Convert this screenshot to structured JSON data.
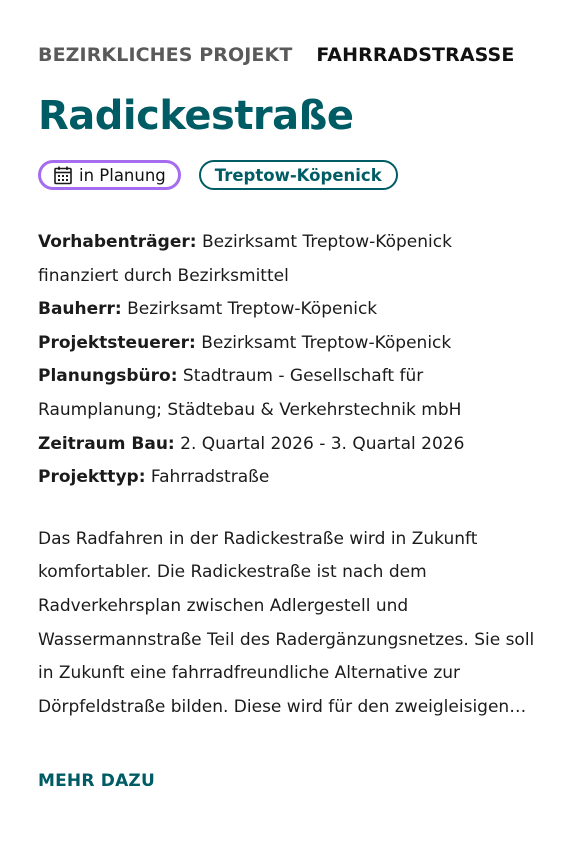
{
  "project": {
    "type_label": "BEZIRKLICHES PROJEKT",
    "category_label": "FAHRRADSTRASSE",
    "title": "Radickestraße",
    "status": {
      "label": "in Planung",
      "icon": "calendar-icon",
      "color": "#a56cf0"
    },
    "district": {
      "label": "Treptow-Köpenick",
      "color": "#005c64"
    },
    "details": [
      {
        "key": "Vorhabenträger:",
        "value": "Bezirksamt Treptow-Köpenick finanziert durch Bezirksmittel"
      },
      {
        "key": "Bauherr:",
        "value": "Bezirksamt Treptow-Köpenick"
      },
      {
        "key": "Projektsteuerer:",
        "value": "Bezirksamt Treptow-Köpenick"
      },
      {
        "key": "Planungsbüro:",
        "value": "Stadtraum - Gesellschaft für Raumplanung; Städtebau & Verkehrstechnik mbH"
      },
      {
        "key": "Zeitraum Bau:",
        "value": "2. Quartal 2026 - 3. Quartal 2026"
      },
      {
        "key": "Projekttyp:",
        "value": "Fahrradstraße"
      }
    ],
    "summary": "Das Radfahren in der Radickestraße wird in Zukunft komfortabler. Die Radickestraße ist nach dem Radverkehrsplan zwischen Adlergestell und Wassermannstraße Teil des Radergänzungsnetzes. Sie soll in Zukunft eine fahrradfreundliche Alternative zur Dörpfeldstraße bilden. Diese wird für den zweigleisigen…",
    "more_label": "MEHR DAZU"
  },
  "colors": {
    "accent": "#005c64",
    "status_border": "#a56cf0",
    "eyebrow_grey": "#5a5a5a"
  }
}
